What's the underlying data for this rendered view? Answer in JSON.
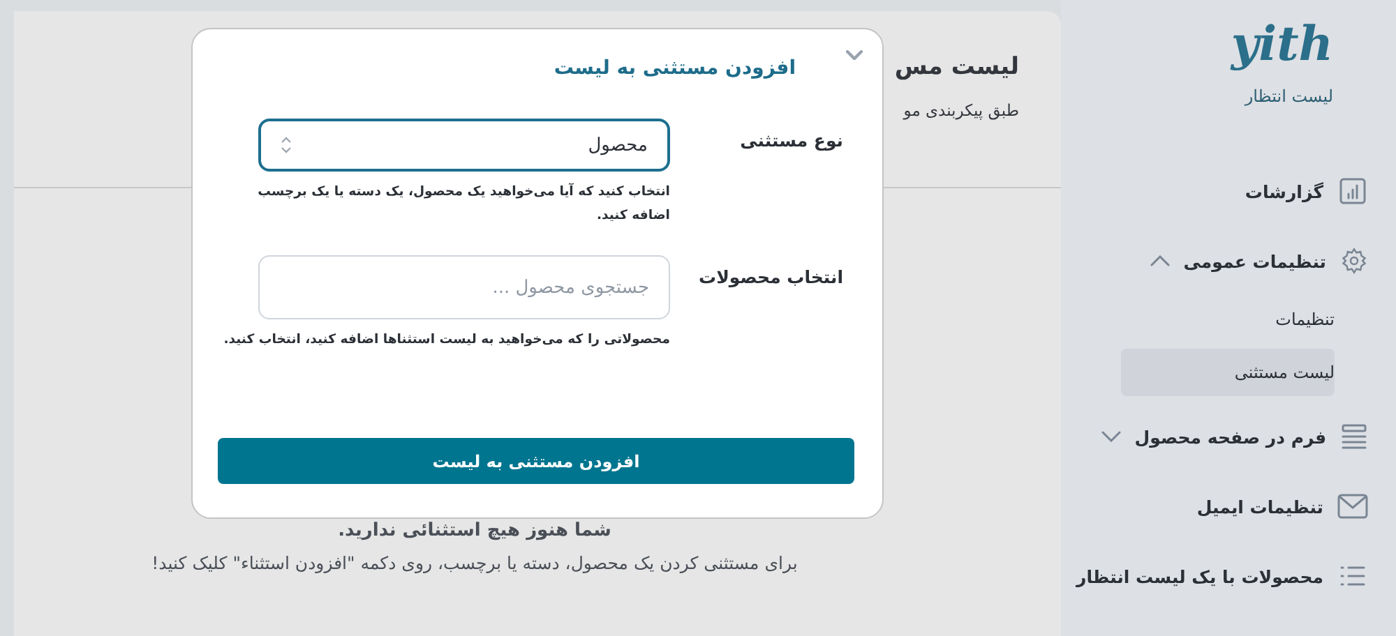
{
  "sidebar": {
    "logo": "yith",
    "subtitle": "لیست انتظار",
    "items": [
      {
        "label": "گزارشات"
      },
      {
        "label": "تنظیمات عمومی",
        "expanded": true,
        "children": [
          {
            "label": "تنظیمات",
            "selected": false
          },
          {
            "label": "لیست مستثنی",
            "selected": true
          }
        ]
      },
      {
        "label": "فرم در صفحه محصول",
        "expanded": false
      },
      {
        "label": "تنظیمات ایمیل"
      },
      {
        "label": "محصولات با یک لیست انتظار"
      }
    ]
  },
  "page": {
    "title": "لیست مس",
    "subtitle": "طبق پیکربندی مو",
    "empty_state": [
      "شما هنوز هیچ استثنائی ندارید.",
      "برای مستثنی کردن یک محصول، دسته یا برچسب، روی دکمه \"افزودن استثناء\" کلیک کنید!"
    ]
  },
  "modal": {
    "title": "افزودن مستثنی به لیست",
    "fields": [
      {
        "kind": "select",
        "label": "نوع مستثنی",
        "value": "محصول",
        "help": "انتخاب کنید که آیا می‌خواهید یک محصول، یک دسته یا یک برچسب اضافه کنید."
      },
      {
        "kind": "search",
        "label": "انتخاب محصولات",
        "placeholder": "جستجوی محصول ...",
        "help": "محصولاتی را که می‌خواهید به لیست استثناها اضافه کنید، انتخاب کنید."
      }
    ],
    "button": "افزودن مستثنی به لیست"
  }
}
